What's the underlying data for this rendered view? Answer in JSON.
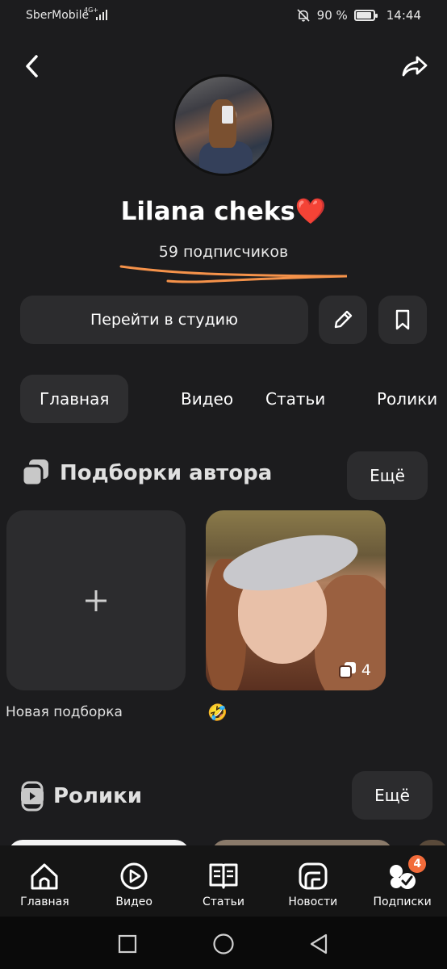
{
  "status_bar": {
    "carrier": "SberMobile",
    "network": "4G+",
    "battery_percent": "90 %",
    "battery_level": 0.9,
    "time": "14:44"
  },
  "header": {
    "back_icon": "chevron-left-icon",
    "share_icon": "share-arrow-icon"
  },
  "profile": {
    "name": "Lilana cheks❤️",
    "subscribers": "59 подписчиков"
  },
  "actions": {
    "studio_label": "Перейти в студию",
    "edit_icon": "pencil-icon",
    "bookmark_icon": "bookmark-icon"
  },
  "tabs": [
    {
      "label": "Главная",
      "active": true
    },
    {
      "label": "Видео",
      "active": false
    },
    {
      "label": "Статьи",
      "active": false
    },
    {
      "label": "Ролики",
      "active": false
    }
  ],
  "collections": {
    "title": "Подборки автора",
    "more_label": "Ещё",
    "new_label": "Новая подборка",
    "items": [
      {
        "label": "🤣",
        "count": "4"
      }
    ]
  },
  "shorts": {
    "title": "Ролики",
    "more_label": "Ещё"
  },
  "bottom_nav": [
    {
      "label": "Главная",
      "icon": "home-icon"
    },
    {
      "label": "Видео",
      "icon": "video-play-icon"
    },
    {
      "label": "Статьи",
      "icon": "book-icon"
    },
    {
      "label": "Новости",
      "icon": "news-icon"
    },
    {
      "label": "Подписки",
      "icon": "subscriptions-icon",
      "badge": "4"
    }
  ],
  "colors": {
    "background": "#1c1c1e",
    "surface": "#2c2c2e",
    "accent_orange": "#f26b3a"
  }
}
